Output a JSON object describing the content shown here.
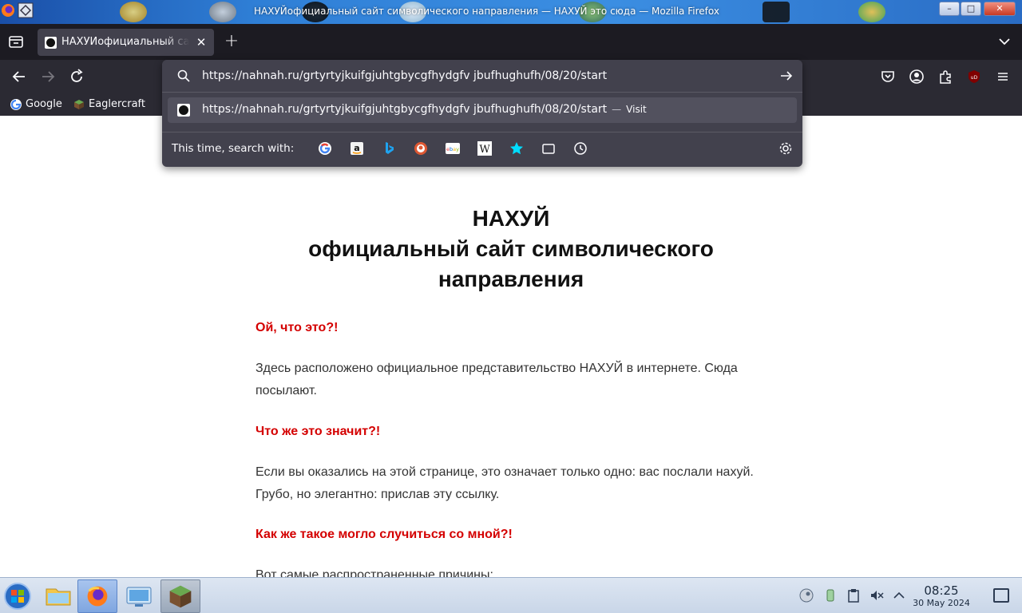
{
  "window": {
    "title": "НАХУЙофициальный сайт символического направления — НАХУЙ это сюда — Mozilla Firefox",
    "controls": {
      "minimize": "–",
      "maximize": "□",
      "close": "✕"
    }
  },
  "tabs": [
    {
      "label": "НАХУЙофициальный сайт символического направления",
      "active": true
    }
  ],
  "urlbar": {
    "value": "https://nahnah.ru/grtyrtyjkuifgjuhtgbycgfhydgfv jbufhughufh/08/20/start",
    "suggestion_url": "https://nahnah.ru/grtyrtyjkuifgjuhtgbycgfhydgfv jbufhughufh/08/20/start",
    "suggestion_sep": "—",
    "suggestion_action": "Visit",
    "search_with_label": "This time, search with:",
    "engines": [
      "google-icon",
      "amazon-icon",
      "bing-icon",
      "duckduckgo-icon",
      "ebay-icon",
      "wikipedia-icon",
      "bookmarks-icon",
      "tabs-icon",
      "history-icon"
    ]
  },
  "bookmarks": [
    {
      "label": "Google",
      "icon": "google-icon"
    },
    {
      "label": "Eaglercraft",
      "icon": "grass-block-icon"
    }
  ],
  "page": {
    "title_line1": "НАХУЙ",
    "title_line2": "официальный сайт символического",
    "title_line3": "направления",
    "heading1": "Ой, что это?!",
    "para1": "Здесь расположено официальное представительство НАХУЙ в интернете. Сюда посылают.",
    "heading2": "Что же это значит?!",
    "para2": "Если вы оказались на этой странице, это означает только одно: вас послали нахуй. Грубо, но элегантно: прислав эту ссылку.",
    "heading3": "Как же такое могло случиться со мной?!",
    "para3": "Вот самые распространенные причины:"
  },
  "taskbar": {
    "time": "08:25",
    "date": "30 May 2024"
  },
  "colors": {
    "heading_red": "#d40000",
    "toolbar_bg": "#2b2a33",
    "tabstrip_bg": "#1c1b22",
    "urlpanel_bg": "#42414d"
  }
}
